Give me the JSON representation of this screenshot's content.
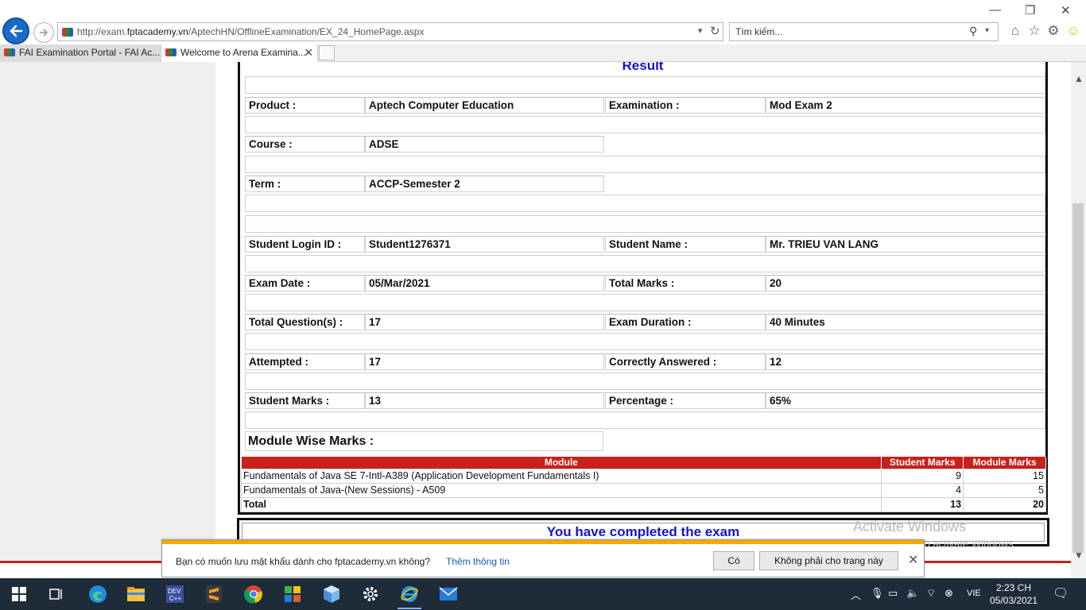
{
  "browser": {
    "url_prefix": "http://exam.",
    "url_domain": "fptacademy.vn",
    "url_path": "/AptechHN/OfflineExamination/EX_24_HomePage.aspx",
    "search_placeholder": "Tìm kiếm...",
    "tabs": [
      {
        "label": "FAI Examination Portal - FAI Ac..."
      },
      {
        "label": "Welcome to Arena Examina..."
      }
    ]
  },
  "result": {
    "title": "Result",
    "fields": {
      "product_label": "Product :",
      "product_value": "Aptech Computer Education",
      "examination_label": "Examination :",
      "examination_value": "Mod Exam 2",
      "course_label": "Course :",
      "course_value": "ADSE",
      "term_label": "Term :",
      "term_value": "ACCP-Semester 2",
      "login_label": "Student Login ID :",
      "login_value": "Student1276371",
      "name_label": "Student Name :",
      "name_value": "Mr. TRIEU VAN LANG",
      "exam_date_label": "Exam Date :",
      "exam_date_value": "05/Mar/2021",
      "total_marks_label": "Total Marks :",
      "total_marks_value": "20",
      "total_questions_label": "Total Question(s) :",
      "total_questions_value": "17",
      "duration_label": "Exam Duration :",
      "duration_value": "40 Minutes",
      "attempted_label": "Attempted :",
      "attempted_value": "17",
      "correct_label": "Correctly Answered :",
      "correct_value": "12",
      "student_marks_label": "Student Marks :",
      "student_marks_value": "13",
      "percentage_label": "Percentage :",
      "percentage_value": "65%"
    },
    "module_wise_heading": "Module Wise Marks :",
    "module_table": {
      "headers": [
        "Module",
        "Student Marks",
        "Module Marks"
      ],
      "rows": [
        [
          "Fundamentals of Java SE 7-Intl-A389 (Application Development Fundamentals I)",
          "9",
          "15"
        ],
        [
          "Fundamentals of Java-(New Sessions) - A509",
          "4",
          "5"
        ]
      ],
      "total": [
        "Total",
        "13",
        "20"
      ]
    },
    "completed_message": "You have completed the exam"
  },
  "watermark": {
    "line1": "Activate Windows",
    "line2": "Go to Settings to activate Windows."
  },
  "password_prompt": {
    "message": "Bạn có muốn lưu mật khẩu dành cho fptacademy.vn không?",
    "link": "Thêm thông tin",
    "yes_button": "Có",
    "no_button": "Không phải cho trang này"
  },
  "taskbar": {
    "language": "VIE",
    "time": "2:23 CH",
    "date": "05/03/2021"
  }
}
